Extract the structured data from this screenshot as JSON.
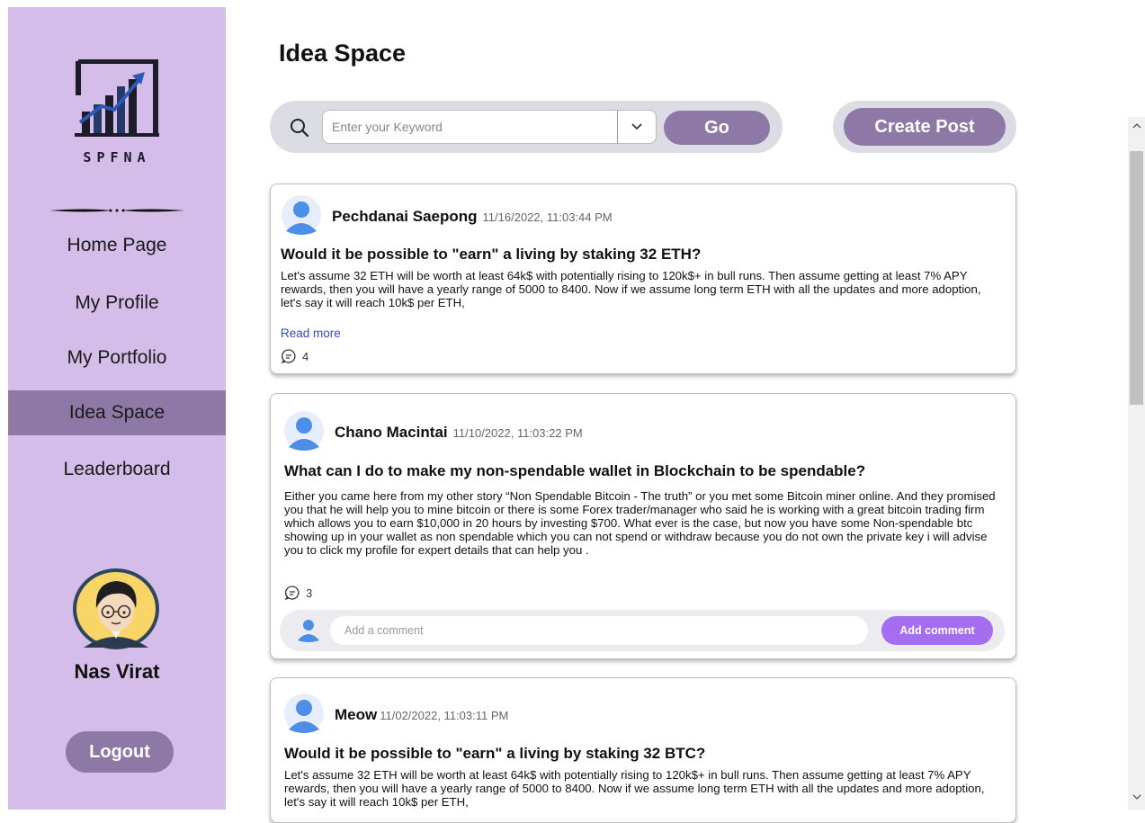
{
  "sidebar": {
    "logo_text": "SPFNA",
    "nav": [
      {
        "label": "Home Page",
        "active": false
      },
      {
        "label": "My Profile",
        "active": false
      },
      {
        "label": "My Portfolio",
        "active": false
      },
      {
        "label": "Idea Space",
        "active": true
      },
      {
        "label": "Leaderboard",
        "active": false
      }
    ],
    "user_name": "Nas Virat",
    "logout_label": "Logout"
  },
  "page": {
    "title": "Idea Space"
  },
  "search": {
    "placeholder": "Enter your Keyword",
    "value": "",
    "go_label": "Go",
    "create_post_label": "Create Post"
  },
  "posts": [
    {
      "author": "Pechdanai Saepong",
      "timestamp": "11/16/2022, 11:03:44 PM",
      "title": "Would it be possible to \"earn\" a living by staking 32 ETH?",
      "body": "Let's assume 32 ETH will be worth at least 64k$ with potentially rising to 120k$+ in bull runs. Then assume getting at least 7% APY rewards, then you will have a yearly range of 5000 to 8400. Now if we assume long term ETH with all the updates and more adoption, let's say it will reach 10k$ per ETH,",
      "read_more_label": "Read more",
      "comment_count": "4"
    },
    {
      "author": "Chano Macintai",
      "timestamp": "11/10/2022, 11:03:22 PM",
      "title": "What can I do to make my non-spendable wallet in Blockchain to be spendable?",
      "body": "Either you came here from my other story “Non Spendable Bitcoin - The truth” or you met some Bitcoin miner online. And they promised you that he will help you to mine bitcoin or there is some Forex trader/manager who said he is working with a great bitcoin trading firm which allows you to earn $10,000 in 20 hours by investing $700. What ever is the case, but now you have some Non-spendable btc showing up in your wallet as non spendable which you can not spend or withdraw because you do not own the private key i will advise you to click my profile for expert details that can help you .",
      "comment_count": "3",
      "comment_placeholder": "Add a comment",
      "add_comment_label": "Add comment"
    },
    {
      "author": "Meow",
      "timestamp": "11/02/2022, 11:03:11 PM",
      "title": "Would it be possible to \"earn\" a living by staking 32 BTC?",
      "body": "Let's assume 32 ETH will be worth at least 64k$ with potentially rising to 120k$+ in bull runs. Then assume getting at least 7% APY rewards, then you will have a yearly range of 5000 to 8400. Now if we assume long term ETH with all the updates and more adoption, let's say it will reach 10k$ per ETH,"
    }
  ],
  "colors": {
    "sidebar_bg": "#d4bde8",
    "accent": "#8e78a6",
    "add_comment": "#a56ef0",
    "link": "#3b48c4",
    "avatar_blue": "#4d8ee8"
  },
  "icons": [
    "spfna-logo",
    "ornament-divider",
    "user-avatar-icon",
    "search-icon",
    "chevron-down-icon",
    "comment-icon",
    "scroll-up-icon",
    "scroll-down-icon"
  ]
}
